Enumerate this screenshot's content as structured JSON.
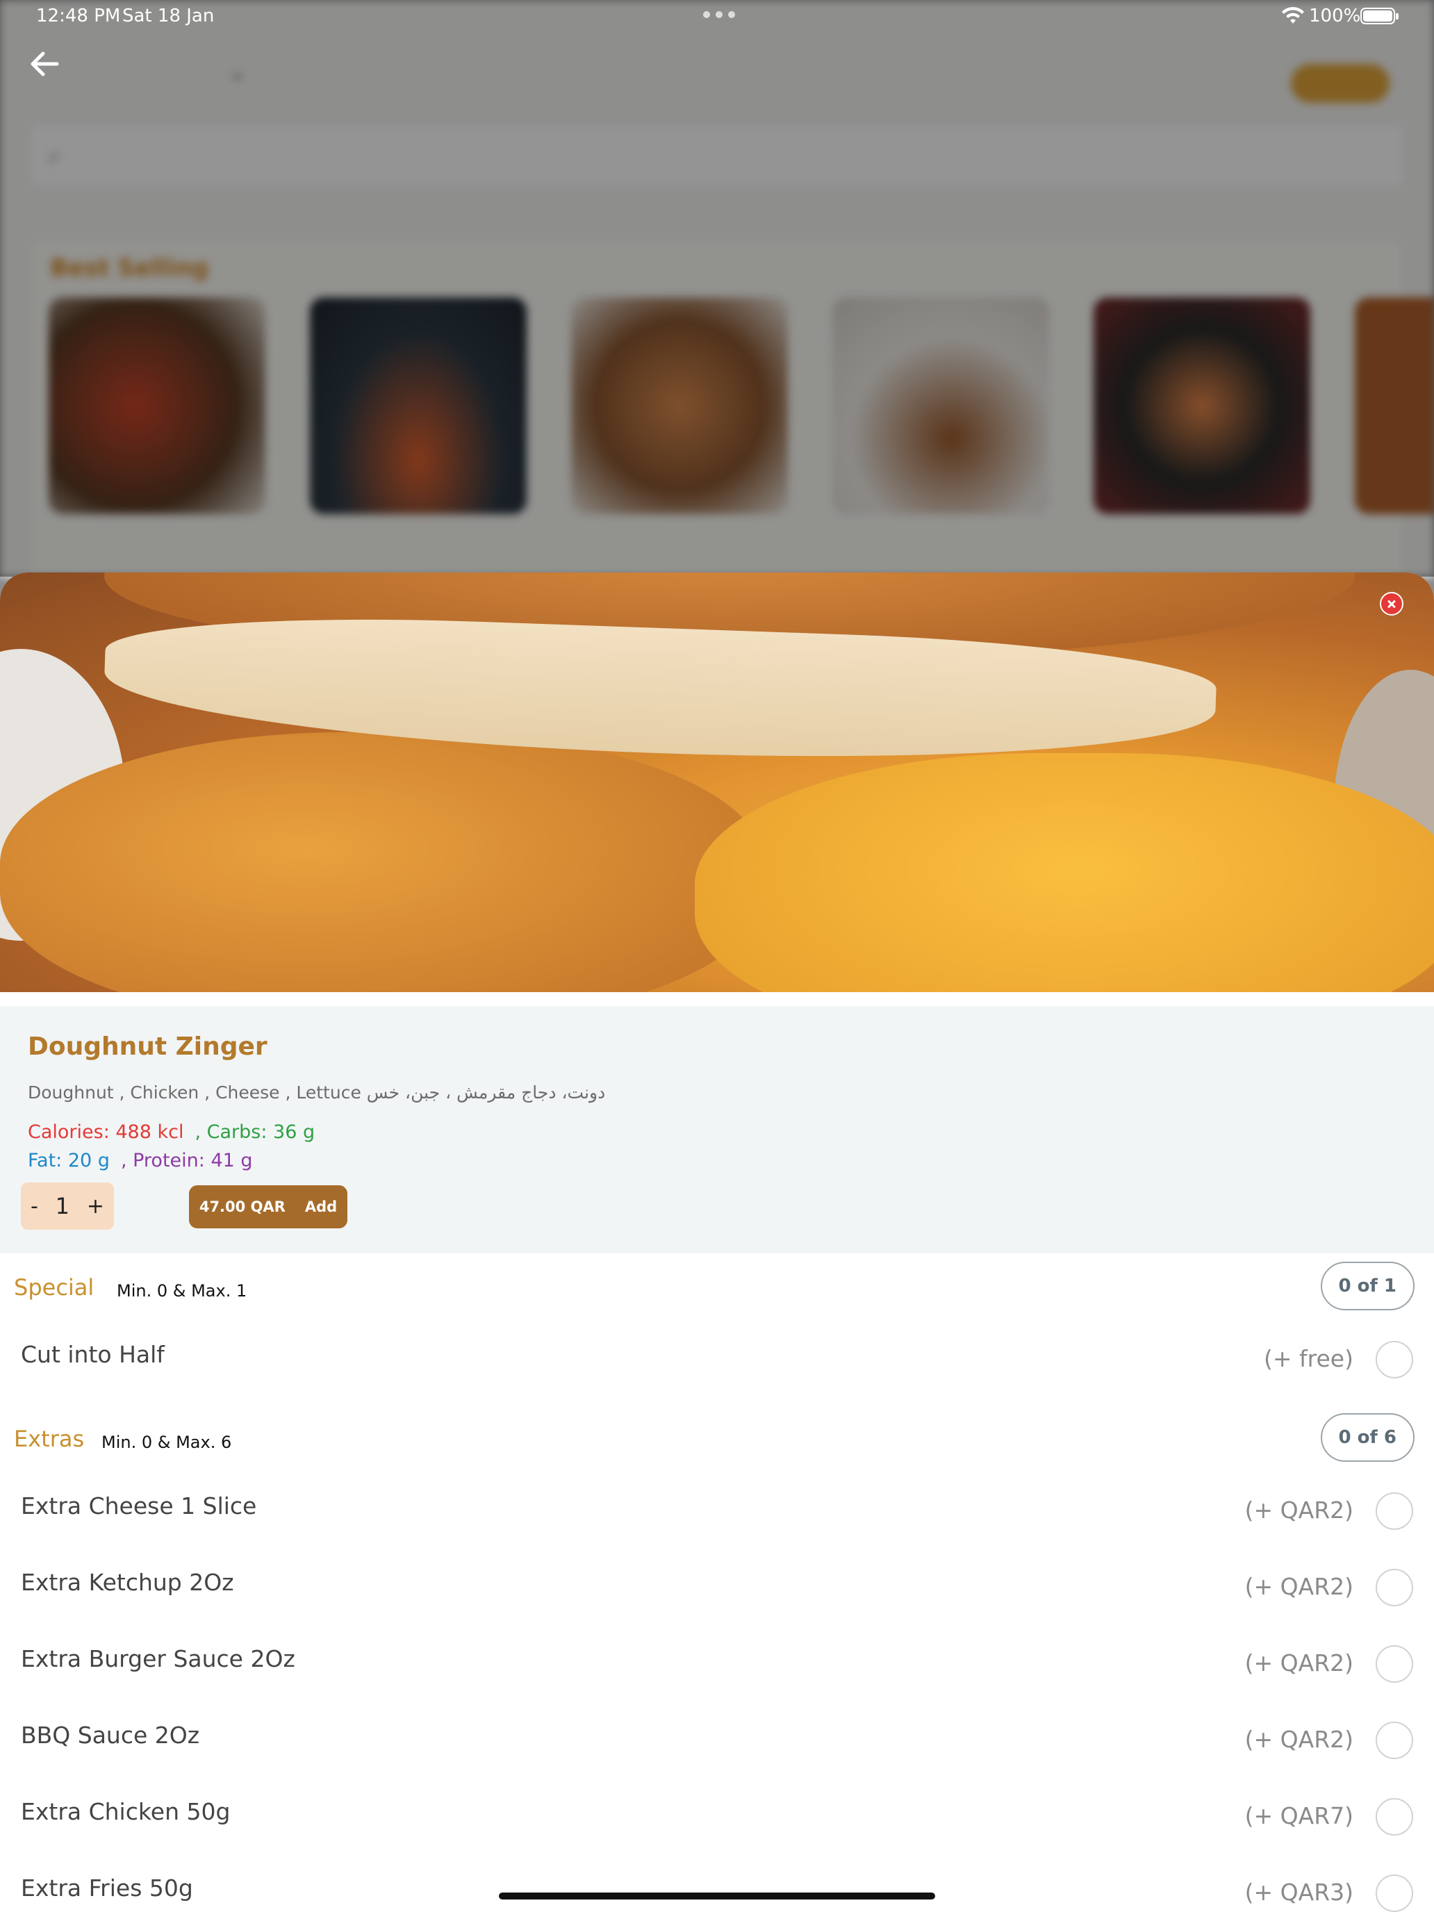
{
  "status_bar": {
    "time": "12:48 PM",
    "date": "Sat 18 Jan",
    "battery": "100%"
  },
  "background": {
    "best_selling_title": "Best Selling"
  },
  "item": {
    "title": "Doughnut Zinger",
    "description": "Doughnut , Chicken , Cheese , Lettuce دونت، دجاج مقرمش ، جبن، خس",
    "calories": "Calories: 488 kcl",
    "carbs": ", Carbs: 36 g",
    "fat": "Fat: 20 g",
    "protein": ", Protein: 41 g",
    "quantity": "1",
    "minus_label": "-",
    "plus_label": "+",
    "price": "47.00 QAR",
    "add_label": "Add"
  },
  "groups": [
    {
      "name": "Special",
      "rule": "Min. 0 & Max. 1",
      "badge": "0 of 1",
      "options": [
        {
          "label": "Cut into Half",
          "price": "(+ free)"
        }
      ]
    },
    {
      "name": "Extras",
      "rule": "Min. 0 & Max. 6",
      "badge": "0 of 6",
      "options": [
        {
          "label": "Extra Cheese 1 Slice",
          "price": "(+ QAR2)"
        },
        {
          "label": "Extra Ketchup 2Oz",
          "price": "(+ QAR2)"
        },
        {
          "label": "Extra Burger Sauce 2Oz",
          "price": "(+ QAR2)"
        },
        {
          "label": "BBQ Sauce 2Oz",
          "price": "(+ QAR2)"
        },
        {
          "label": "Extra Chicken 50g",
          "price": "(+ QAR7)"
        },
        {
          "label": "Extra Fries 50g",
          "price": "(+ QAR3)"
        }
      ]
    }
  ],
  "colors": {
    "accent": "#b37a2c",
    "add_button": "#a56b2a",
    "close_button": "#e53935",
    "calories": "#e53935",
    "carbs": "#2ea043",
    "fat": "#1e88c8",
    "protein": "#8e3aa6"
  },
  "icons": {
    "back": "arrow-left-icon",
    "close": "close-icon",
    "wifi": "wifi-icon",
    "battery": "battery-icon",
    "radio": "radio-empty-icon"
  }
}
